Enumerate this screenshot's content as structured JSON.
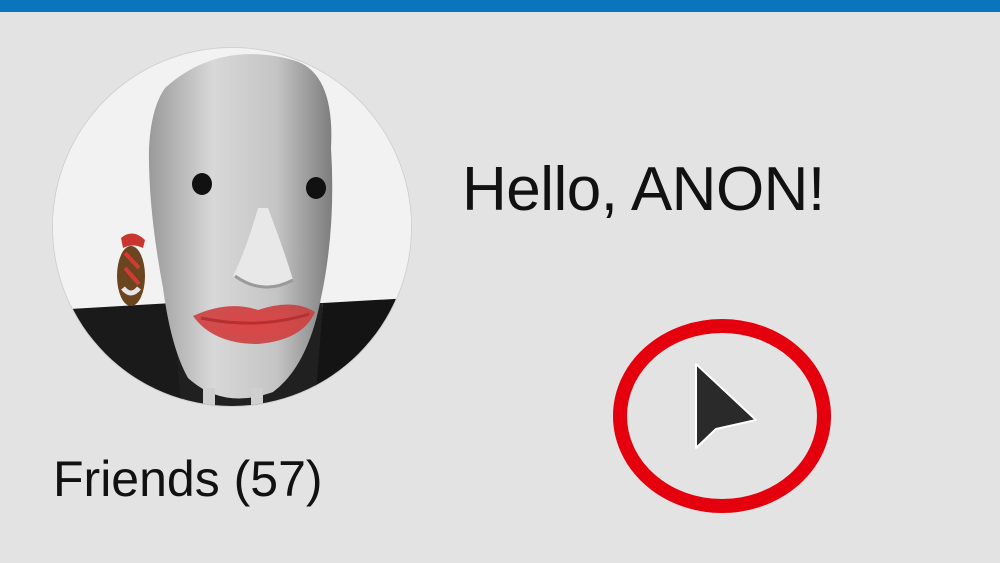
{
  "header": {
    "bar_color": "#0a74bd"
  },
  "profile": {
    "avatar_icon": "user-avatar",
    "greeting": "Hello, ANON!",
    "friends_link": "Friends (57)"
  },
  "annotation": {
    "highlight_color": "#e4000c",
    "cursor_icon": "mouse-pointer-icon"
  }
}
